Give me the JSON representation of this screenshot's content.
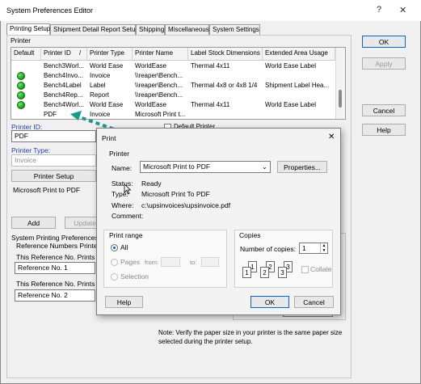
{
  "window": {
    "title": "System Preferences Editor",
    "help_glyph": "?",
    "close_glyph": "✕"
  },
  "tabs": [
    "Printing Setup",
    "Shipment Detail Report Setup",
    "Shipping",
    "Miscellaneous",
    "System Settings"
  ],
  "side_buttons": {
    "ok": "OK",
    "apply": "Apply",
    "cancel": "Cancel",
    "help": "Help"
  },
  "printer_group": {
    "title": "Printer",
    "columns": [
      "Default",
      "Printer ID",
      "/",
      "Printer Type",
      "Printer Name",
      "Label Stock Dimensions",
      "Extended Area Usage"
    ],
    "rows": [
      {
        "default": false,
        "id": "Bench3Worl...",
        "type": "World Ease",
        "name": "WorldEase",
        "stock": "Thermal 4x11",
        "area": "World Ease Label"
      },
      {
        "default": true,
        "id": "Bench4Invo...",
        "type": "Invoice",
        "name": "\\\\reaper\\Bench...",
        "stock": "",
        "area": ""
      },
      {
        "default": true,
        "id": "Bench4Label",
        "type": "Label",
        "name": "\\\\reaper\\Bench...",
        "stock": "Thermal 4x8 or 4x8 1/4",
        "area": "Shipment Label Hea..."
      },
      {
        "default": true,
        "id": "Bench4Rep...",
        "type": "Report",
        "name": "\\\\reaper\\Bench...",
        "stock": "",
        "area": ""
      },
      {
        "default": true,
        "id": "Bench4Worl...",
        "type": "World Ease",
        "name": "WorldEase",
        "stock": "Thermal 4x11",
        "area": "World Ease Label"
      },
      {
        "default": false,
        "id": "PDF",
        "type": "Invoice",
        "name": "Microsoft Print t...",
        "stock": "",
        "area": ""
      }
    ]
  },
  "left_form": {
    "printer_id_label": "Printer ID:",
    "printer_id_value": "PDF",
    "printer_type_label": "Printer Type:",
    "printer_type_value": "Invoice",
    "printer_setup_button": "Printer Setup",
    "printer_name_value": "Microsoft Print to PDF",
    "add_button": "Add",
    "update_button": "Update",
    "default_printer_label": "Default Printer"
  },
  "system_printing": {
    "title": "System Printing Preferences",
    "ref_printed_label": "Reference Numbers Printed on",
    "ref1_label": "This Reference No. Prints on th",
    "ref1_value": "Reference No. 1",
    "ref2_label": "This Reference No. Prints on th",
    "ref2_value": "Reference No. 2"
  },
  "note": "Note: Verify the paper size in your printer is the same paper size selected during the printer setup.",
  "print_dialog": {
    "title": "Print",
    "close_glyph": "✕",
    "printer_section": "Printer",
    "name_label": "Name:",
    "name_value": "Microsoft Print to PDF",
    "properties_button": "Properties...",
    "status_label": "Status:",
    "status_value": "Ready",
    "type_label": "Type:",
    "type_value": "Microsoft Print To PDF",
    "where_label": "Where:",
    "where_value": "c:\\upsinvoices\\upsinvoice.pdf",
    "comment_label": "Comment:",
    "comment_value": "",
    "range_section": "Print range",
    "range_all": "All",
    "range_pages": "Pages",
    "range_from": "from:",
    "range_to": "to:",
    "range_selection": "Selection",
    "copies_section": "Copies",
    "copies_label": "Number of copies:",
    "copies_value": "1",
    "collate_label": "Collate",
    "collate_glyphs": [
      "1",
      "1",
      "2",
      "2",
      "3",
      "3"
    ],
    "help_button": "Help",
    "ok_button": "OK",
    "cancel_button": "Cancel"
  },
  "colors": {
    "accent": "#0a64c8",
    "annotation_arrow": "#1a9a8a",
    "status_dot": "#14a014"
  }
}
